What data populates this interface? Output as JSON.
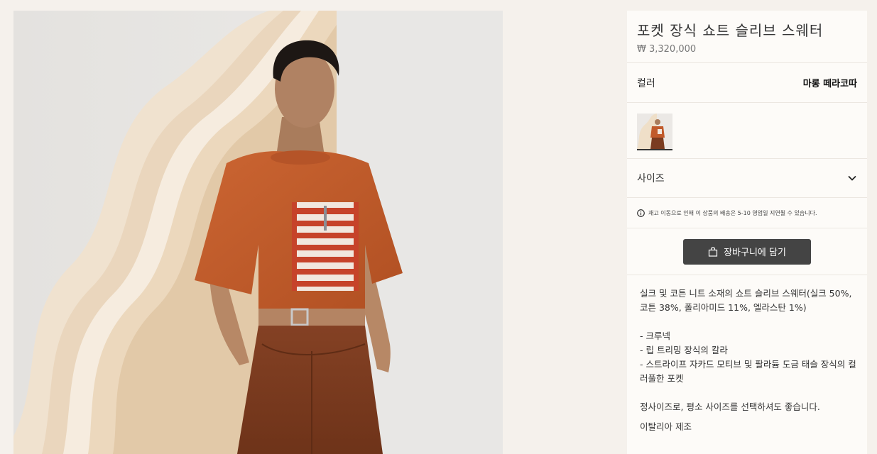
{
  "product": {
    "title": "포켓 장식 쇼트 슬리브 스웨터",
    "price": "₩ 3,320,000"
  },
  "color": {
    "label": "컬러",
    "value": "마롱 떼라코따"
  },
  "size": {
    "label": "사이즈"
  },
  "notice": {
    "text": "재고 이동으로 인해 이 상품의 배송은 5-10 영업일 지연될 수 있습니다."
  },
  "cart": {
    "label": "장바구니에 담기"
  },
  "description": {
    "intro": "실크 및 코튼 니트 소재의 쇼트 슬리브 스웨터(실크 50%, 코튼 38%, 폴리아미드 11%, 엘라스탄 1%)",
    "features": [
      "- 크루넥",
      "- 립 트리밍 장식의 칼라",
      "- 스트라이프 자카드 모티브 및 팔라듐 도금 태슬 장식의 컬러풀한 포켓"
    ],
    "fit": "정사이즈로, 평소 사이즈를 선택하셔도 좋습니다.",
    "origin": "이탈리아 제조"
  },
  "icons": {
    "info": "info-icon",
    "chevron": "chevron-down-icon",
    "bag": "shopping-bag-icon"
  },
  "colors": {
    "sweater": "#c15a2b",
    "pants": "#7a3b20",
    "button": "#444444"
  }
}
